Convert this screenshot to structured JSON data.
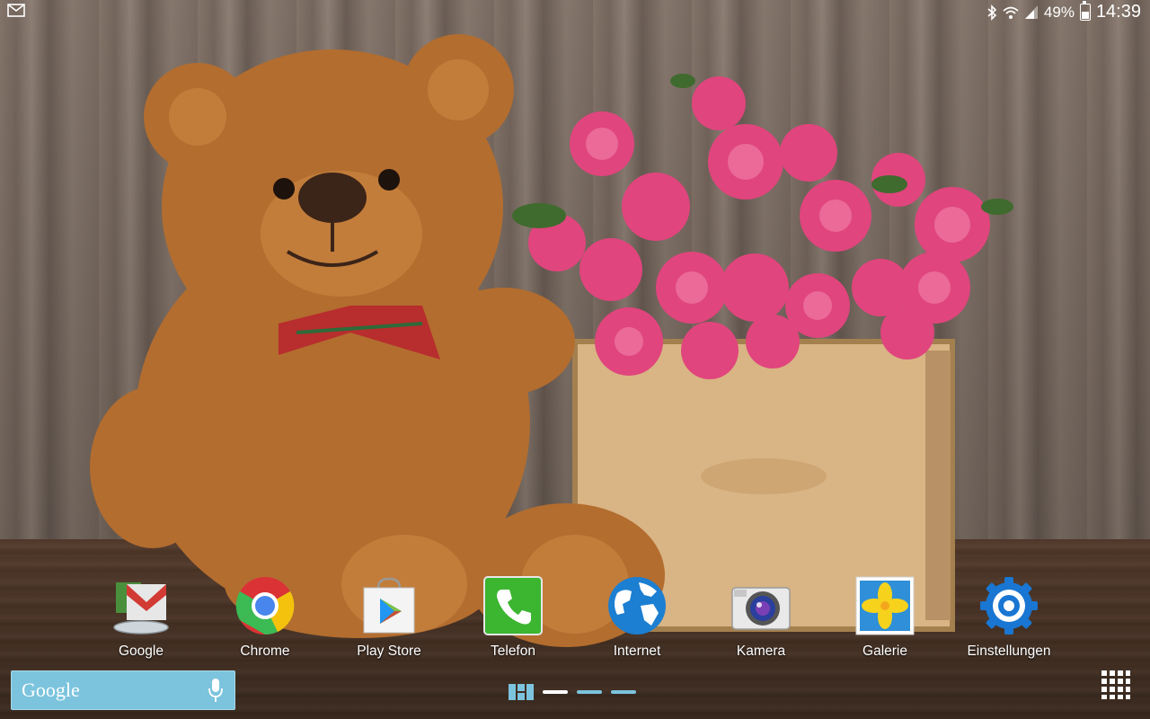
{
  "status_bar": {
    "notification_icon": "gmail-envelope-icon",
    "bluetooth_icon": "bluetooth-icon",
    "wifi_icon": "wifi-icon",
    "signal_icon": "signal-bars-icon",
    "battery_percent": "49%",
    "battery_level": 0.49,
    "time": "14:39"
  },
  "dock": {
    "apps": [
      {
        "label": "Google",
        "icon": "google-folder-icon"
      },
      {
        "label": "Chrome",
        "icon": "chrome-icon"
      },
      {
        "label": "Play Store",
        "icon": "play-store-icon"
      },
      {
        "label": "Telefon",
        "icon": "phone-icon"
      },
      {
        "label": "Internet",
        "icon": "internet-globe-icon"
      },
      {
        "label": "Kamera",
        "icon": "camera-icon"
      },
      {
        "label": "Galerie",
        "icon": "gallery-icon"
      },
      {
        "label": "Einstellungen",
        "icon": "settings-gear-icon"
      }
    ]
  },
  "google_search": {
    "logo_text": "Google",
    "mic_icon": "microphone-icon"
  },
  "page_indicator": {
    "home_icon": "home-screens-icon",
    "current_page": 1,
    "page_count": 3
  },
  "apps_button": {
    "icon": "app-grid-icon"
  },
  "colors": {
    "search_bar": "#7cc4dd",
    "indicator_active": "#ffffff",
    "indicator_inactive": "#7cc4dd"
  }
}
